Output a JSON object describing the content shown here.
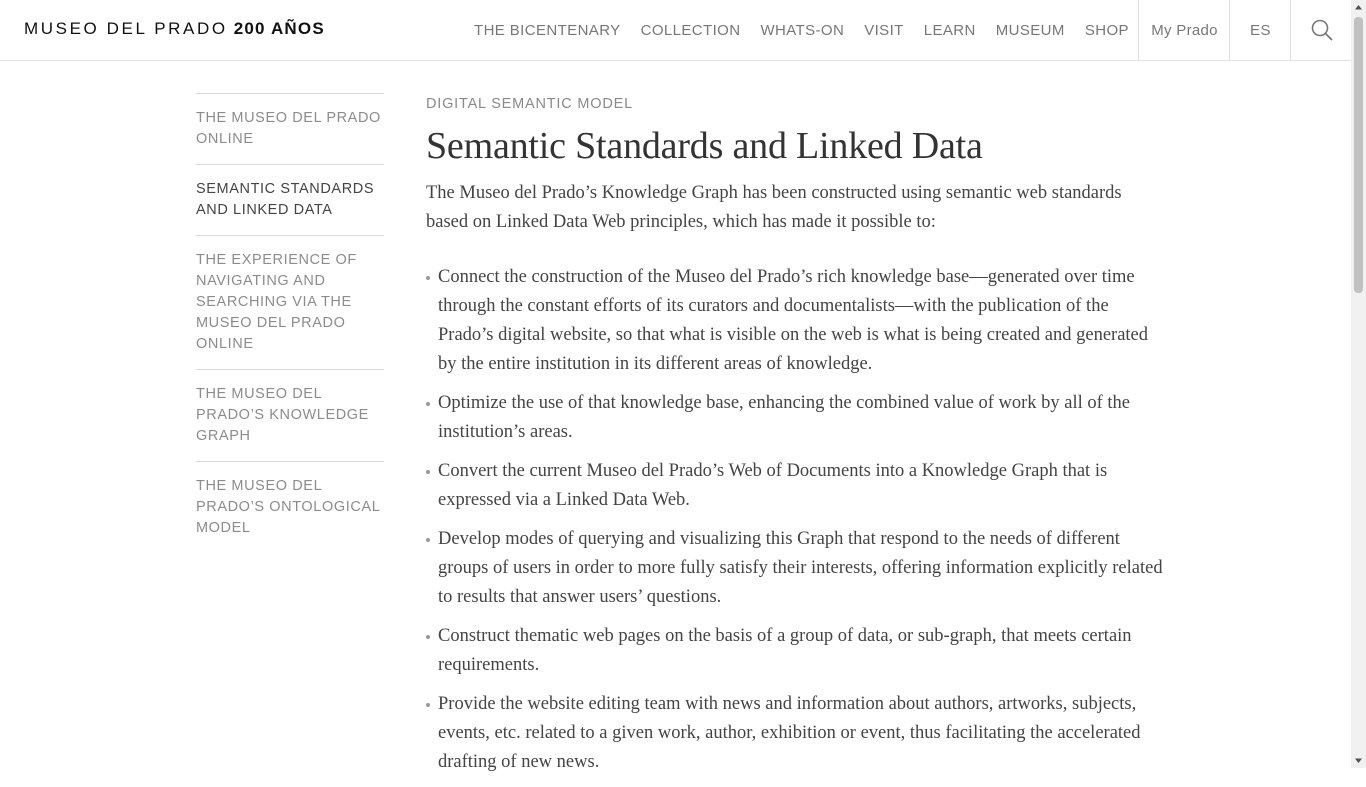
{
  "header": {
    "logo_text": "MUSEO DEL PRADO",
    "logo_bold": "200 AÑOS",
    "nav": [
      "THE BICENTENARY",
      "COLLECTION",
      "WHATS-ON",
      "VISIT",
      "LEARN",
      "MUSEUM",
      "SHOP"
    ],
    "my_prado": "My Prado",
    "language": "ES",
    "search_icon": "search-icon"
  },
  "sidebar": {
    "items": [
      {
        "label": "THE MUSEO DEL PRADO ONLINE",
        "active": false
      },
      {
        "label": "SEMANTIC STANDARDS AND LINKED DATA",
        "active": true
      },
      {
        "label": "THE EXPERIENCE OF NAVIGATING AND SEARCHING VIA THE MUSEO DEL PRADO ONLINE",
        "active": false
      },
      {
        "label": "THE MUSEO DEL PRADO’S KNOWLEDGE GRAPH",
        "active": false
      },
      {
        "label": "THE MUSEO DEL PRADO’S ONTOLOGICAL MODEL",
        "active": false
      }
    ]
  },
  "main": {
    "kicker": "DIGITAL SEMANTIC MODEL",
    "title": "Semantic Standards and Linked Data",
    "intro": "The Museo del Prado’s Knowledge Graph has been constructed using semantic web standards based on Linked Data Web principles, which has made it possible to:",
    "bullets": [
      "Connect the construction of the Museo del Prado’s rich knowledge base—generated over time through the constant efforts of its curators and documentalists—with the publication of the Prado’s digital website, so that what is visible on the web is what is being created and generated by the entire institution in its different areas of knowledge.",
      "Optimize the use of that knowledge base, enhancing the combined value of work by all of the institution’s areas.",
      "Convert the current Museo del Prado’s Web of Documents into a Knowledge Graph that is expressed via a Linked Data Web.",
      "Develop modes of querying and visualizing this Graph that respond to the needs of different groups of users in order to more fully satisfy their interests, offering information explicitly related to results that answer users’ questions.",
      "Construct thematic web pages on the basis of a group of data, or sub-graph, that meets certain requirements.",
      "Provide the website editing team with news and information about authors, artworks, subjects, events, etc. related to a given work, author, exhibition or event, thus facilitating the accelerated drafting of new news."
    ]
  },
  "colors": {
    "text": "#444444",
    "muted": "#8c8c8c",
    "border": "#e2e2e2"
  }
}
